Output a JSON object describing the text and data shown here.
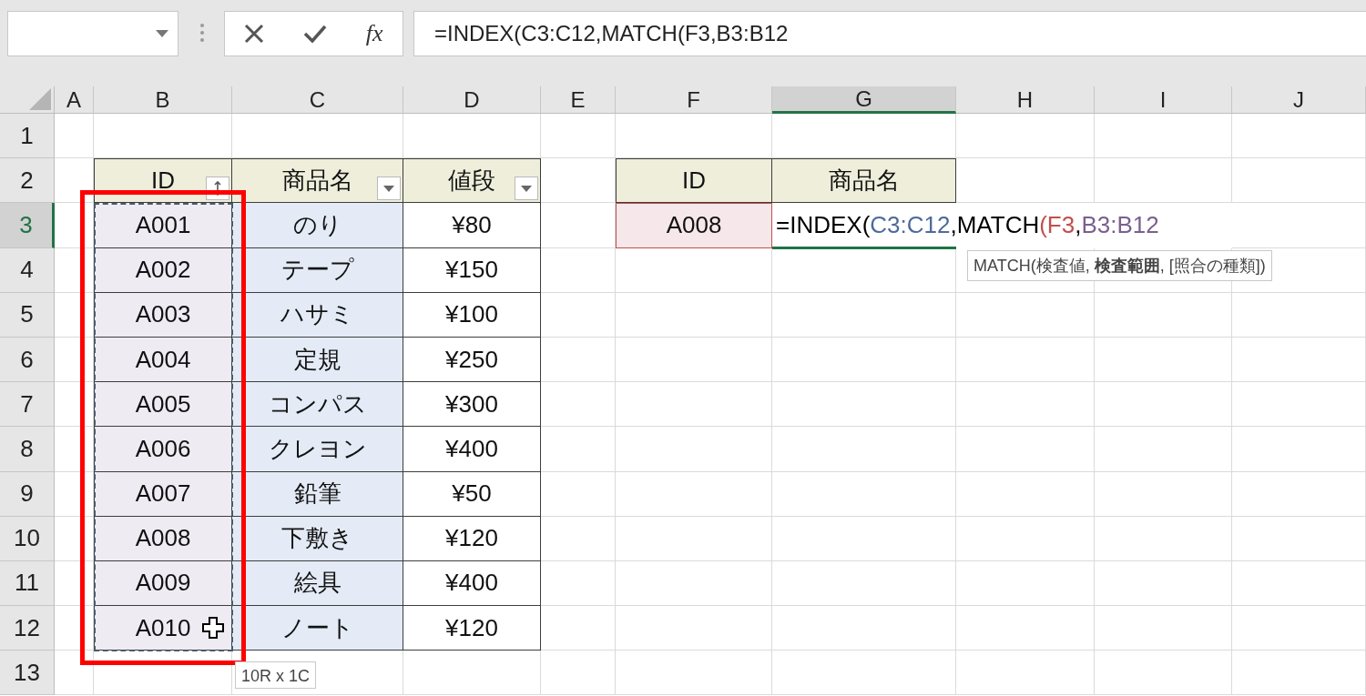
{
  "formula_bar": {
    "function_label": "fx",
    "formula": "=INDEX(C3:C12,MATCH(F3,B3:B12"
  },
  "columns": [
    {
      "label": "A",
      "selected": false
    },
    {
      "label": "B",
      "selected": false
    },
    {
      "label": "C",
      "selected": false
    },
    {
      "label": "D",
      "selected": false
    },
    {
      "label": "E",
      "selected": false
    },
    {
      "label": "F",
      "selected": false
    },
    {
      "label": "G",
      "selected": true
    },
    {
      "label": "H",
      "selected": false
    },
    {
      "label": "I",
      "selected": false
    },
    {
      "label": "J",
      "selected": false
    }
  ],
  "rows": [
    {
      "label": "1",
      "selected": false
    },
    {
      "label": "2",
      "selected": false
    },
    {
      "label": "3",
      "selected": true
    },
    {
      "label": "4",
      "selected": false
    },
    {
      "label": "5",
      "selected": false
    },
    {
      "label": "6",
      "selected": false
    },
    {
      "label": "7",
      "selected": false
    },
    {
      "label": "8",
      "selected": false
    },
    {
      "label": "9",
      "selected": false
    },
    {
      "label": "10",
      "selected": false
    },
    {
      "label": "11",
      "selected": false
    },
    {
      "label": "12",
      "selected": false
    },
    {
      "label": "13",
      "selected": false
    }
  ],
  "table": {
    "headers": [
      {
        "label": "ID",
        "kind": "sorted"
      },
      {
        "label": "商品名",
        "kind": "dropdown"
      },
      {
        "label": "値段",
        "kind": "dropdown"
      }
    ],
    "rows": [
      [
        "A001",
        "のり",
        "¥80"
      ],
      [
        "A002",
        "テープ",
        "¥150"
      ],
      [
        "A003",
        "ハサミ",
        "¥100"
      ],
      [
        "A004",
        "定規",
        "¥250"
      ],
      [
        "A005",
        "コンパス",
        "¥300"
      ],
      [
        "A006",
        "クレヨン",
        "¥400"
      ],
      [
        "A007",
        "鉛筆",
        "¥50"
      ],
      [
        "A008",
        "下敷き",
        "¥120"
      ],
      [
        "A009",
        "絵具",
        "¥400"
      ],
      [
        "A010",
        "ノート",
        "¥120"
      ]
    ]
  },
  "lookup": {
    "headers": [
      "ID",
      "商品名"
    ],
    "value": "A008",
    "formula_parts": [
      {
        "text": "=INDEX(",
        "color": "#000000"
      },
      {
        "text": "C3:C12",
        "color": "#4e6a9c"
      },
      {
        "text": ",MATCH",
        "color": "#000000"
      },
      {
        "text": "(F3",
        "color": "#c0504d"
      },
      {
        "text": ",",
        "color": "#000000"
      },
      {
        "text": "B3:B12",
        "color": "#7b5f8f"
      }
    ]
  },
  "hint_tooltip": "MATCH(検査値, **検査範囲**, [照合の種類])",
  "size_tooltip": "10R x 1C"
}
